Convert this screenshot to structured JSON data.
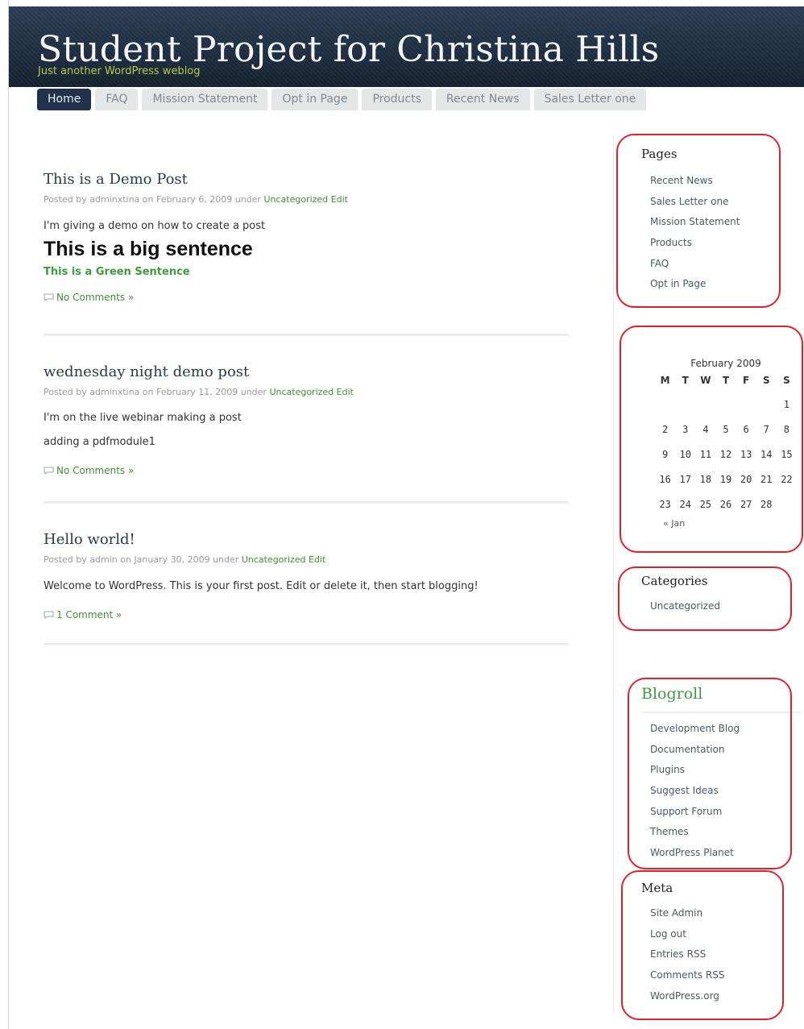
{
  "site": {
    "title": "Student Project for Christina Hills",
    "tagline": "Just another WordPress weblog"
  },
  "nav": {
    "tabs": [
      "Home",
      "FAQ",
      "Mission Statement",
      "Opt in Page",
      "Products",
      "Recent News",
      "Sales Letter one"
    ],
    "active": "Home"
  },
  "posts": [
    {
      "title": "This is a Demo Post",
      "meta_prefix": "Posted by adminxtina on February 6, 2009 under",
      "category": "Uncategorized",
      "edit": "Edit",
      "body": "I'm giving a demo on how to create a post",
      "big_sentence": "This is a big sentence",
      "green_sentence": "This is a Green Sentence",
      "comments": "No Comments »"
    },
    {
      "title": "wednesday night demo post",
      "meta_prefix": "Posted by adminxtina on February 11, 2009 under",
      "category": "Uncategorized",
      "edit": "Edit",
      "body": "I'm on the live webinar making a post",
      "body2": "adding a pdfmodule1",
      "comments": "No Comments »"
    },
    {
      "title": "Hello world!",
      "meta_prefix": "Posted by admin on January 30, 2009 under",
      "category": "Uncategorized",
      "edit": "Edit",
      "body": "Welcome to WordPress. This is your first post. Edit or delete it, then start blogging!",
      "comments": "1 Comment »"
    }
  ],
  "sidebar": {
    "pages": {
      "title": "Pages",
      "items": [
        "Recent News",
        "Sales Letter one",
        "Mission Statement",
        "Products",
        "FAQ",
        "Opt in Page"
      ]
    },
    "calendar": {
      "caption": "February 2009",
      "days": [
        "M",
        "T",
        "W",
        "T",
        "F",
        "S",
        "S"
      ],
      "weeks": [
        [
          "",
          "",
          "",
          "",
          "",
          "",
          "1"
        ],
        [
          "2",
          "3",
          "4",
          "5",
          "6",
          "7",
          "8"
        ],
        [
          "9",
          "10",
          "11",
          "12",
          "13",
          "14",
          "15"
        ],
        [
          "16",
          "17",
          "18",
          "19",
          "20",
          "21",
          "22"
        ],
        [
          "23",
          "24",
          "25",
          "26",
          "27",
          "28",
          ""
        ]
      ],
      "prev": "« Jan"
    },
    "categories": {
      "title": "Categories",
      "items": [
        "Uncategorized"
      ]
    },
    "blogroll": {
      "title": "Blogroll",
      "items": [
        "Development Blog",
        "Documentation",
        "Plugins",
        "Suggest Ideas",
        "Support Forum",
        "Themes",
        "WordPress Planet"
      ]
    },
    "meta": {
      "title": "Meta",
      "items": [
        "Site Admin",
        "Log out",
        "Entries RSS",
        "Comments RSS",
        "WordPress.org"
      ]
    }
  },
  "colors": {
    "header_bg": "#1f2f42",
    "link_green": "#3f8f33",
    "annotation_red": "#e0202a",
    "active_tab": "#20334a"
  }
}
